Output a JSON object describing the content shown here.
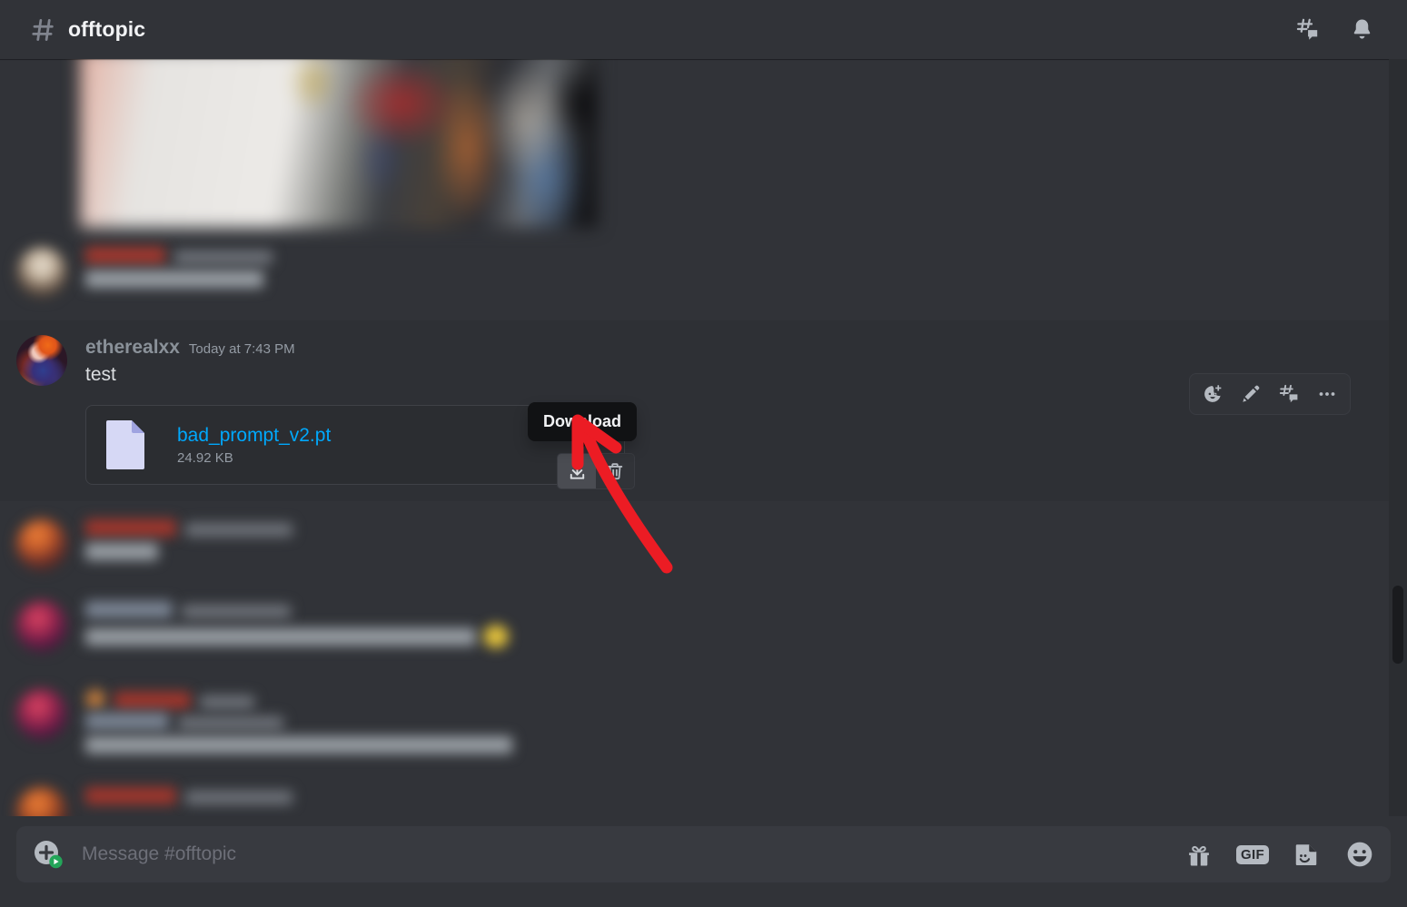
{
  "header": {
    "hash_icon": "hash-icon",
    "channel_name": "offtopic",
    "threads_icon": "threads-icon",
    "notifications_icon": "bell-icon"
  },
  "messages": {
    "image_attachment": {
      "alt": "blurred image attachment"
    },
    "censored_above": {
      "username": "",
      "timestamp": "",
      "content": ""
    },
    "focused": {
      "username": "etherealxx",
      "timestamp": "Today at 7:43 PM",
      "content": "test",
      "attachment": {
        "file_name": "bad_prompt_v2.pt",
        "file_size": "24.92 KB",
        "file_icon": "file-icon",
        "download_icon": "download-icon",
        "delete_icon": "trash-icon"
      },
      "tooltip": "Download",
      "hover_actions": [
        {
          "name": "add-reaction-icon",
          "label": "Add Reaction"
        },
        {
          "name": "edit-icon",
          "label": "Edit"
        },
        {
          "name": "thread-icon",
          "label": "Create Thread"
        },
        {
          "name": "more-icon",
          "label": "More"
        }
      ]
    },
    "censored_below": [
      {
        "username": "",
        "timestamp": "",
        "content": ""
      },
      {
        "username": "",
        "timestamp": "",
        "content": ""
      },
      {
        "username": "",
        "timestamp": "",
        "content": ""
      },
      {
        "username": "",
        "timestamp": "",
        "content": ""
      }
    ]
  },
  "composer": {
    "placeholder": "Message #offtopic",
    "value": "",
    "attach_icon": "plus-circle-icon",
    "gift_icon": "gift-icon",
    "gif_label": "GIF",
    "sticker_icon": "sticker-icon",
    "emoji_icon": "emoji-icon"
  },
  "annotation": {
    "arrow_color": "#ec1c24",
    "points_to": "download-button"
  },
  "colors": {
    "app_background": "#313338",
    "header_background": "#313338",
    "hovered_message_background": "#2e3035",
    "composer_background": "#383a40",
    "attachment_card_background": "#2b2d31",
    "link_blue": "#00a8fc",
    "username_color": "#8a9199",
    "timestamp_color": "#949ba4",
    "text_color": "#dbdee1",
    "tooltip_background": "#111214",
    "scrollbar_track": "#2b2d31",
    "scrollbar_thumb": "#1a1b1e"
  }
}
